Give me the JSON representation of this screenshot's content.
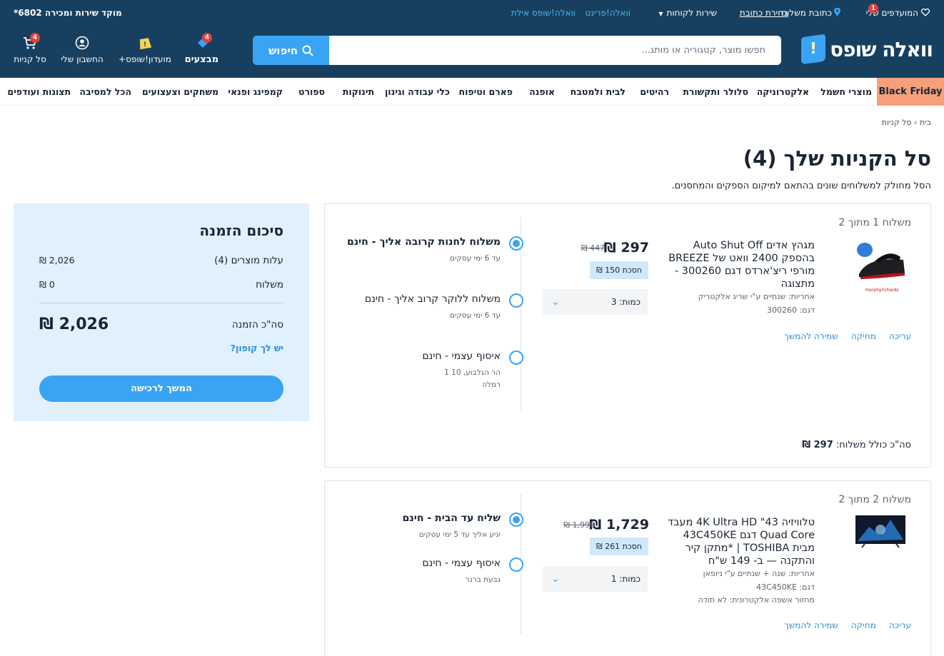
{
  "topstrip": {
    "favorites": "המועדפים שלי",
    "favorites_badge": "1",
    "ship_address": "כתובת משלוח",
    "choose_address": "בחירת כתובת",
    "customer_service": "שירות לקוחות",
    "walla_print": "וואלה!פרינט",
    "walla_eilat": "וואלה!שופס אילת",
    "hotline": "מוקד שירות ומכירה 6802*"
  },
  "header": {
    "logo_text": "וואלה שופס",
    "search_placeholder": "חפשו מוצר, קטגוריה או מותג...",
    "search_button": "חיפוש",
    "deals_label": "מבצעים",
    "deals_badge": "4",
    "club_label": "מועדון!שופס+",
    "account_label": "החשבון שלי",
    "cart_label": "סל קניות",
    "cart_badge": "4"
  },
  "categories": [
    "Black Friday",
    "מוצרי חשמל",
    "אלקטרוניקה",
    "סלולר ותקשורת",
    "רהיטים",
    "לבית ולמטבח",
    "אופנה",
    "פארם וטיפוח",
    "כלי עבודה וגינון",
    "תינוקות",
    "ספורט",
    "קמפינג ופנאי",
    "משחקים וצעצועים",
    "הכל למסיבה",
    "תצוגות ועודפים"
  ],
  "breadcrumb": "בית › סל קניות",
  "page": {
    "title": "סל הקניות שלך (4)",
    "subtitle": "הסל מחולק למשלוחים שונים בהתאם למיקום הספקים והמחסנים."
  },
  "shipments": [
    {
      "header": "משלוח 1 מתוך 2",
      "product": {
        "title": "מגהץ אדים Auto Shut Off בהספק 2400 וואט של BREEZE מורפי ריצ'ארדס דגם 300260 - מתצוגה",
        "warranty": "אחריות: שנתיים ע\"י שריג אלקטריק",
        "model": "דגם: 300260",
        "price": "297 ₪",
        "old_price": "447 ₪",
        "savings": "חסכת 150 ₪",
        "quantity": "כמות: 3"
      },
      "actions": [
        "עריכה",
        "מחיקה",
        "שמירה להמשך"
      ],
      "options": [
        {
          "title": "משלוח לחנות קרובה אליך - חינם",
          "sub": "עד 6 ימי עסקים",
          "selected": true
        },
        {
          "title": "משלוח ללוקר קרוב אליך - חינם",
          "sub": "עד 6 ימי עסקים",
          "selected": false
        },
        {
          "title": "איסוף עצמי - חינם",
          "sub": "הר הגלבוע, 10 1\nרמלה",
          "selected": false
        }
      ],
      "total_label": "סה\"כ כולל משלוח:",
      "total_value": "297 ₪"
    },
    {
      "header": "משלוח 2 מתוך 2",
      "product": {
        "title": "טלוויזיה 43\" 4K Ultra HD מעבד Quad Core דגם 43C450KE מבית TOSHIBA | *מתקן קיר והתקנה — ב- 149 ש\"ח",
        "warranty": "אחריות: שנה + שנתיים ע\"י ניופאן",
        "model": "דגם: 43C450KE",
        "recycling": "מחזור אשפה אלקטרונית: לא תודה",
        "price": "1,729 ₪",
        "old_price": "1,990 ₪",
        "savings": "חסכת 261 ₪",
        "quantity": "כמות: 1"
      },
      "actions": [
        "עריכה",
        "מחיקה",
        "שמירה להמשך"
      ],
      "options": [
        {
          "title": "שליח עד הבית - חינם",
          "sub": "יגיע אליך עד 5 ימי עסקים",
          "selected": true
        },
        {
          "title": "איסוף עצמי - חינם",
          "sub": "גבעת ברנר",
          "selected": false
        }
      ]
    }
  ],
  "summary": {
    "title": "סיכום הזמנה",
    "items_label": "עלות מוצרים (4)",
    "items_value": "2,026 ₪",
    "shipping_label": "משלוח",
    "shipping_value": "0 ₪",
    "total_label": "סה\"כ הזמנה",
    "total_value": "2,026 ₪",
    "coupon": "יש לך קופון?",
    "checkout": "המשך לרכישה"
  },
  "colors": {
    "header_bg": "#173f5f",
    "accent": "#3aa4f4",
    "black_friday": "#f5a07a",
    "summary_bg": "#e1f0fd",
    "badge": "#e23f3f"
  }
}
